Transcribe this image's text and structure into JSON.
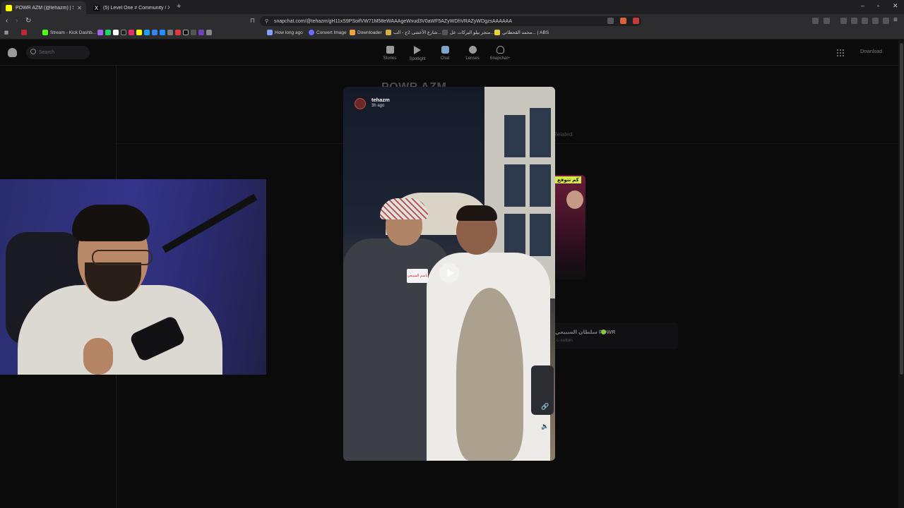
{
  "browser": {
    "tabs": [
      {
        "title": "POWR AZM (@tehazm) | Snapch",
        "favicon_color": "#fffc00"
      },
      {
        "title": "(5) Level One ≠ Community / X",
        "favicon_color": "#ffffff"
      }
    ],
    "url": "snapchat.com/@tehazm/gH11xS9PSoifVW71M58eWAAAgeWxud3V0aWF5AZyWDhVRAZyWDgzsAAAAAA",
    "bookmarks": [
      "Stream - Kick Dashb...",
      "How long ago",
      "Convert Image",
      "Downloader",
      "شارع الأعشى 2ج - الب...",
      "متجر بيلو البركات عل...",
      "محمد القحطاني... | ABS"
    ]
  },
  "snapchat": {
    "search_placeholder": "Search",
    "nav": [
      "Stories",
      "Spotlight",
      "Chat",
      "Lenses",
      "Snapchat+"
    ],
    "download_label": "Download",
    "profile_title": "POWR AZM",
    "related_label": "Related",
    "thumb_caption": "كم تتوقع",
    "suggested": {
      "name": "سلطان السبيعي POWR",
      "username": "c-sultan"
    },
    "story": {
      "user": "tehazm",
      "time": "3h ago",
      "mic_label": "باسم السبيعي"
    }
  },
  "colors": {
    "snap_yellow": "#fffc00",
    "verified_green": "#8cc63f",
    "accent_red": "#c0282d"
  }
}
